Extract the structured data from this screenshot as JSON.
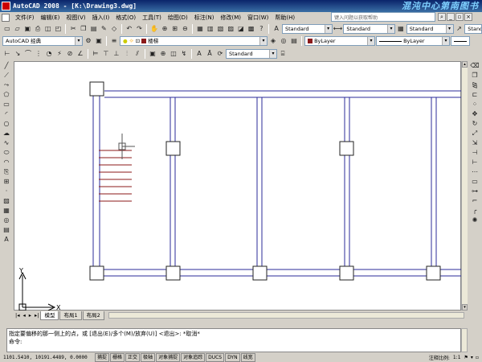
{
  "window": {
    "title": "AutoCAD 2008 - [K:\\Drawing3.dwg]",
    "brand": "混沌中心第南图书"
  },
  "menu": [
    "文件(F)",
    "编辑(E)",
    "视图(V)",
    "插入(I)",
    "格式(O)",
    "工具(T)",
    "绘图(D)",
    "标注(N)",
    "修改(M)",
    "窗口(W)",
    "帮助(H)"
  ],
  "help_search": {
    "placeholder": "键入问题以获取帮助"
  },
  "toolbar_workspace": {
    "workspace": "AutoCAD 经典",
    "layer": "楼梯"
  },
  "styles": {
    "text_style": "Standard",
    "dim_style": "Standard",
    "table_style": "Standard",
    "multileader_style": "Standar"
  },
  "properties": {
    "color": "ByLayer",
    "linetype": "ByLayer"
  },
  "dimension_toolbar": {
    "style": "Standard"
  },
  "ucs": {
    "x_label": "X",
    "y_label": "Y"
  },
  "layout_tabs": [
    "模型",
    "布局1",
    "布局2"
  ],
  "command_line": {
    "history": "指定要偏移的那一侧上的点，或 [退出(E)/多个(M)/放弃(U)] <退出>:  *取消*",
    "prompt": "命令:"
  },
  "status_bar": {
    "coords": "1101.5410, 10191.4489, 0.0000",
    "toggles": [
      "捕捉",
      "栅格",
      "正交",
      "极轴",
      "对象捕捉",
      "对象追踪",
      "DUCS",
      "DYN",
      "线宽"
    ],
    "annotation_scale_label": "注释比例:",
    "annotation_scale": "1:1"
  },
  "colors": {
    "frame": "#2b2b9a",
    "stairs": "#8b1a1a",
    "canvas": "#ffffff",
    "chrome": "#d4d0c8",
    "title": "#0a246a"
  }
}
